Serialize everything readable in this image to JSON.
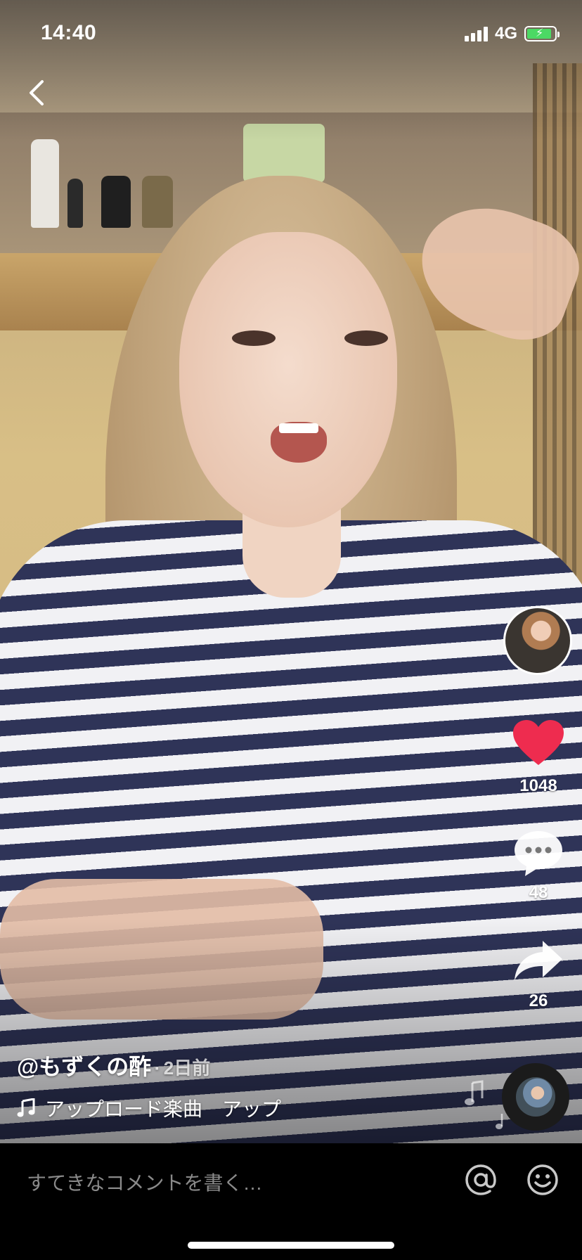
{
  "status_bar": {
    "time": "14:40",
    "network": "4G",
    "battery_charging": true,
    "accent_battery": "#4cd964"
  },
  "video": {
    "author": {
      "username": "@もずくの酢",
      "separator": "·",
      "posted": "2日前"
    },
    "music": {
      "title": "アップロード楽曲　アップ",
      "icon": "music-note-icon"
    }
  },
  "actions": {
    "like": {
      "count": "1048",
      "icon": "heart-icon",
      "color": "#ee2c4f"
    },
    "comment": {
      "count": "48",
      "icon": "comment-bubble-icon"
    },
    "share": {
      "count": "26",
      "icon": "share-arrow-icon"
    }
  },
  "comment_bar": {
    "placeholder": "すてきなコメントを書く…",
    "mention_icon": "at-icon",
    "emoji_icon": "smiley-icon"
  },
  "nav": {
    "back_icon": "chevron-left-icon"
  }
}
